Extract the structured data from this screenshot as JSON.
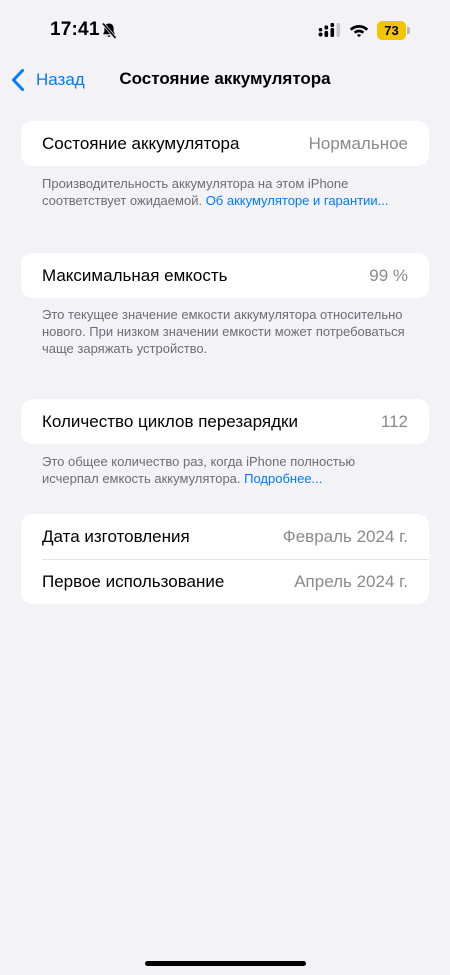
{
  "status_bar": {
    "time": "17:41",
    "battery_level": "73",
    "battery_color": "#f5c400",
    "icons": [
      "bell-slash-icon",
      "cellular-signal-icon",
      "wifi-icon",
      "battery-icon"
    ]
  },
  "nav": {
    "back_label": "Назад",
    "title": "Состояние аккумулятора",
    "accent_color": "#007aff"
  },
  "battery_health": {
    "label": "Состояние аккумулятора",
    "value": "Нормальное",
    "footnote_text": "Производительность аккумулятора на этом iPhone соответствует ожидаемой. ",
    "footnote_link": "Об аккумуляторе и гарантии..."
  },
  "max_capacity": {
    "label": "Максимальная емкость",
    "value": "99 %",
    "footnote_text": "Это текущее значение емкости аккумулятора относительно нового. При низком значении емкости может потребоваться чаще заряжать устройство."
  },
  "cycle_count": {
    "label": "Количество циклов перезарядки",
    "value": "112",
    "footnote_text": "Это общее количество раз, когда iPhone полностью исчерпал емкость аккумулятора. ",
    "footnote_link": "Подробнее..."
  },
  "dates": {
    "manufacture_label": "Дата изготовления",
    "manufacture_value": "Февраль 2024 г.",
    "first_use_label": "Первое использование",
    "first_use_value": "Апрель 2024 г."
  }
}
